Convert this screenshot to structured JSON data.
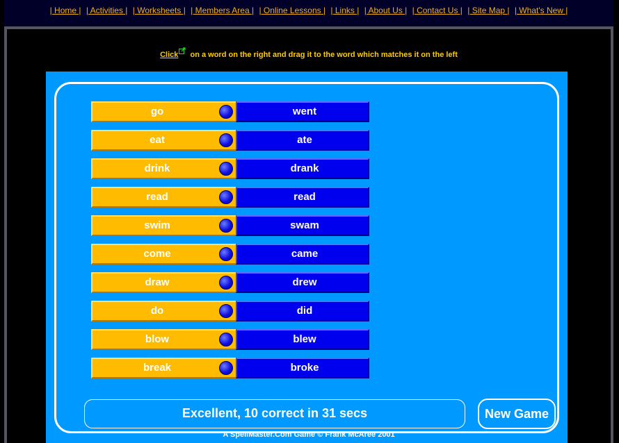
{
  "nav": {
    "links": [
      "| Home |",
      "| Activities |",
      "| Worksheets |",
      "| Members Area |",
      "| Online Lessons |",
      "| Links |",
      "| About Us |",
      "| Contact Us |",
      "| Site Map |",
      "| What's New |"
    ]
  },
  "instruction": {
    "click_label": "Click",
    "rest": "on a word on the right and drag it to the word which matches it on the left"
  },
  "game": {
    "pairs": [
      {
        "left": "go",
        "right": "went"
      },
      {
        "left": "eat",
        "right": "ate"
      },
      {
        "left": "drink",
        "right": "drank"
      },
      {
        "left": "read",
        "right": "read"
      },
      {
        "left": "swim",
        "right": "swam"
      },
      {
        "left": "come",
        "right": "came"
      },
      {
        "left": "draw",
        "right": "drew"
      },
      {
        "left": "do",
        "right": "did"
      },
      {
        "left": "blow",
        "right": "blew"
      },
      {
        "left": "break",
        "right": "broke"
      }
    ],
    "status": "Excellent, 10 correct in 31 secs",
    "new_game_label": "New Game",
    "credit": "A SpellMaster.Com Game © Frank McAree 2001"
  },
  "colors": {
    "background": "#000000",
    "nav_link": "#f0b020",
    "instruction_text": "#ffcc00",
    "game_bg": "#0099ff",
    "left_tile": "#ffbb00",
    "right_tile": "#0000ee"
  },
  "icons": {
    "external_link": "external-link-icon",
    "connector": "connector-knob-icon"
  }
}
